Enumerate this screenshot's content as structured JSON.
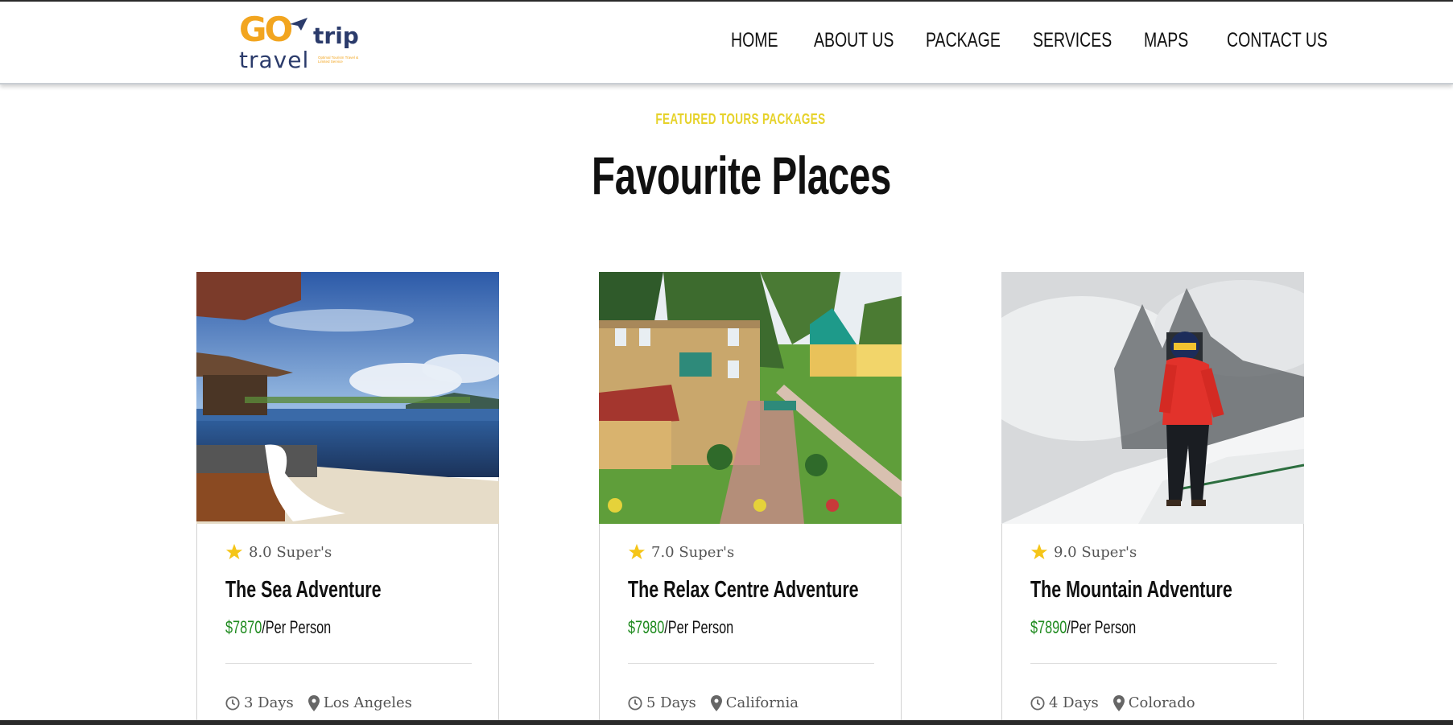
{
  "brand": {
    "logo_go": "GO",
    "logo_trip": "trip",
    "logo_travel": "travel",
    "logo_tagline": "Optimal Tourism Travel & Limited Service"
  },
  "nav": {
    "items": [
      {
        "label": "HOME"
      },
      {
        "label": "ABOUT US"
      },
      {
        "label": "PACKAGE"
      },
      {
        "label": "SERVICES"
      },
      {
        "label": "MAPS"
      },
      {
        "label": "CONTACT US"
      }
    ]
  },
  "section": {
    "kicker": "FEATURED TOURS PACKAGES",
    "title": "Favourite Places"
  },
  "cards": [
    {
      "image": "infinity-pool-sea-view",
      "rating": "8.0 Super's",
      "title": "The Sea Adventure",
      "price": "$7870",
      "price_unit": "/Per Person",
      "duration": "3 Days",
      "location": "Los Angeles"
    },
    {
      "image": "resort-houses-garden",
      "rating": "7.0 Super's",
      "title": "The Relax Centre Adventure",
      "price": "$7980",
      "price_unit": "/Per Person",
      "duration": "5 Days",
      "location": "California"
    },
    {
      "image": "mountain-climber-snow",
      "rating": "9.0 Super's",
      "title": "The Mountain Adventure",
      "price": "$7890",
      "price_unit": "/Per Person",
      "duration": "4 Days",
      "location": "Colorado"
    }
  ],
  "icons": {
    "star": "star-icon",
    "clock": "clock-icon",
    "location": "location-pin-icon"
  },
  "colors": {
    "kicker": "#e6d22a",
    "price": "#1e8a1e",
    "star": "#f5c518",
    "logo_orange": "#f2a51f",
    "logo_navy": "#2b3b6b"
  }
}
